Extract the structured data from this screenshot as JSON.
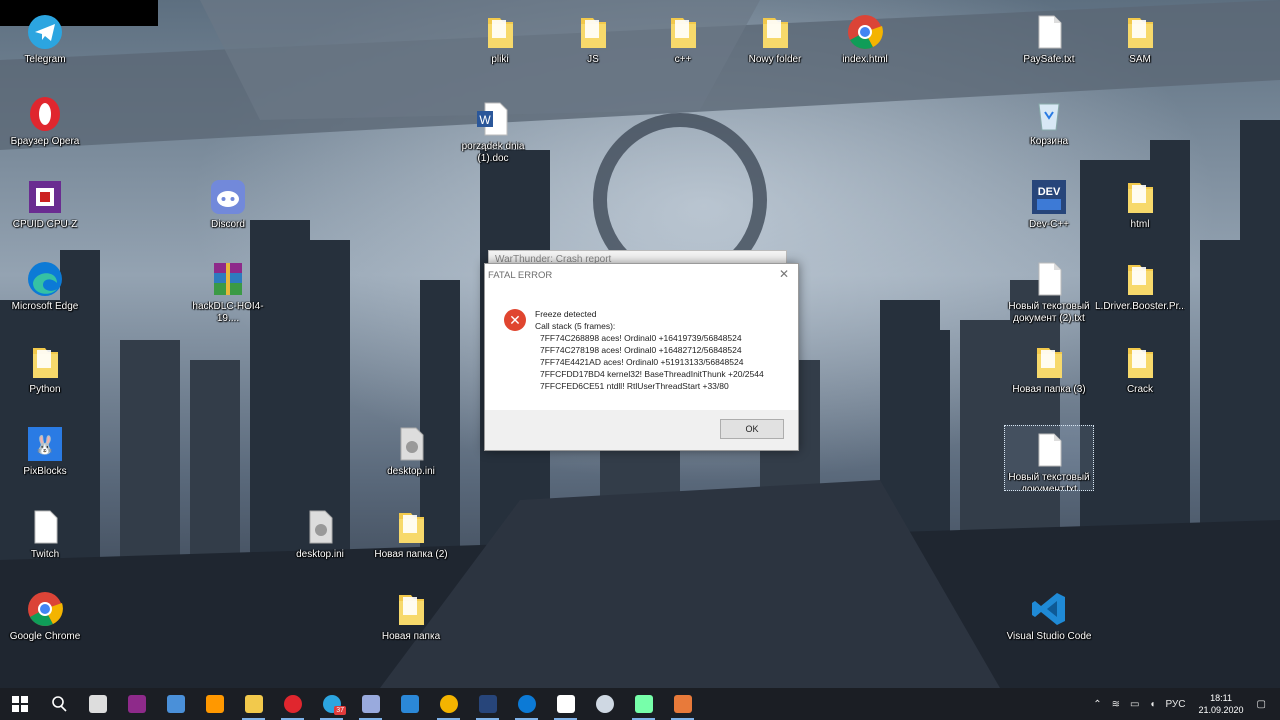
{
  "desktop": {
    "icons": [
      {
        "label": "Telegram",
        "icon": "telegram-icon"
      },
      {
        "label": "Браузер Opera",
        "icon": "opera-icon"
      },
      {
        "label": "CPUID CPU-Z",
        "icon": "cpuz-icon"
      },
      {
        "label": "Microsoft Edge",
        "icon": "edge-icon"
      },
      {
        "label": "Python",
        "icon": "folder-icon"
      },
      {
        "label": "PixBlocks",
        "icon": "pixblocks-icon"
      },
      {
        "label": "Twitch",
        "icon": "file-icon"
      },
      {
        "label": "Google Chrome",
        "icon": "chrome-icon"
      },
      {
        "label": "Discord",
        "icon": "discord-icon"
      },
      {
        "label": "hackDLC-HOI4-19....",
        "icon": "winrar-icon"
      },
      {
        "label": "desktop.ini",
        "icon": "ini-file-icon"
      },
      {
        "label": "pliki",
        "icon": "folder-icon"
      },
      {
        "label": "JS",
        "icon": "folder-icon"
      },
      {
        "label": "c++",
        "icon": "folder-icon"
      },
      {
        "label": "Nowy folder",
        "icon": "folder-icon"
      },
      {
        "label": "index.html",
        "icon": "chrome-icon"
      },
      {
        "label": "porządek dnia\n(1).doc",
        "icon": "word-doc-icon"
      },
      {
        "label": "desktop.ini",
        "icon": "ini-file-icon"
      },
      {
        "label": "Новая папка (2)",
        "icon": "folder-icon"
      },
      {
        "label": "Новая папка",
        "icon": "folder-icon"
      },
      {
        "label": "PaySafe.txt",
        "icon": "txt-file-icon"
      },
      {
        "label": "Корзина",
        "icon": "recycle-bin-icon"
      },
      {
        "label": "Dev-C++",
        "icon": "devcpp-icon"
      },
      {
        "label": "Новый текстовый\nдокумент (2).txt",
        "icon": "txt-file-icon"
      },
      {
        "label": "Новая папка (3)",
        "icon": "folder-icon"
      },
      {
        "label": "Новый текстовый\nдокумент.txt",
        "icon": "txt-file-icon"
      },
      {
        "label": "Visual Studio Code",
        "icon": "vscode-icon"
      },
      {
        "label": "SAM",
        "icon": "folder-icon"
      },
      {
        "label": "html",
        "icon": "folder-icon"
      },
      {
        "label": "L.Driver.Booster.Pr...",
        "icon": "folder-icon"
      },
      {
        "label": "Crack",
        "icon": "folder-icon"
      }
    ]
  },
  "crash_report": {
    "title": "WarThunder: Crash report"
  },
  "fatal_dialog": {
    "title": "FATAL ERROR",
    "close_glyph": "✕",
    "heading": "Freeze detected",
    "subheading": "Call stack (5 frames):",
    "frames": [
      "7FF74C268898 aces! Ordinal0  +16419739/56848524",
      "7FF74C278198 aces! Ordinal0  +16482712/56848524",
      "7FF74E4421AD aces! Ordinal0  +51913133/56848524",
      "7FFCFDD17BD4 kernel32! BaseThreadInitThunk  +20/2544",
      "7FFCFED6CE51 ntdll! RtlUserThreadStart  +33/80"
    ],
    "ok_label": "OK"
  },
  "taskbar": {
    "apps": [
      {
        "icon": "windows-start-icon"
      },
      {
        "icon": "search-icon"
      },
      {
        "icon": "task-view-icon"
      },
      {
        "icon": "winrar-icon"
      },
      {
        "icon": "installer-icon"
      },
      {
        "icon": "sublime-icon"
      },
      {
        "icon": "file-explorer-icon"
      },
      {
        "icon": "opera-icon"
      },
      {
        "icon": "telegram-icon",
        "badge": "37"
      },
      {
        "icon": "notepad-icon"
      },
      {
        "icon": "mail-icon"
      },
      {
        "icon": "chrome-icon"
      },
      {
        "icon": "devcpp-icon"
      },
      {
        "icon": "edge-icon"
      },
      {
        "icon": "document-icon"
      },
      {
        "icon": "steam-icon"
      },
      {
        "icon": "app-window-icon"
      },
      {
        "icon": "warthunder-icon"
      }
    ],
    "tray": {
      "lang": "РУС",
      "time": "18:11",
      "date": "21.09.2020"
    }
  },
  "colors": {
    "taskbar": "#1b1e24",
    "accent": "#7fb2e8",
    "error": "#e0452f"
  }
}
